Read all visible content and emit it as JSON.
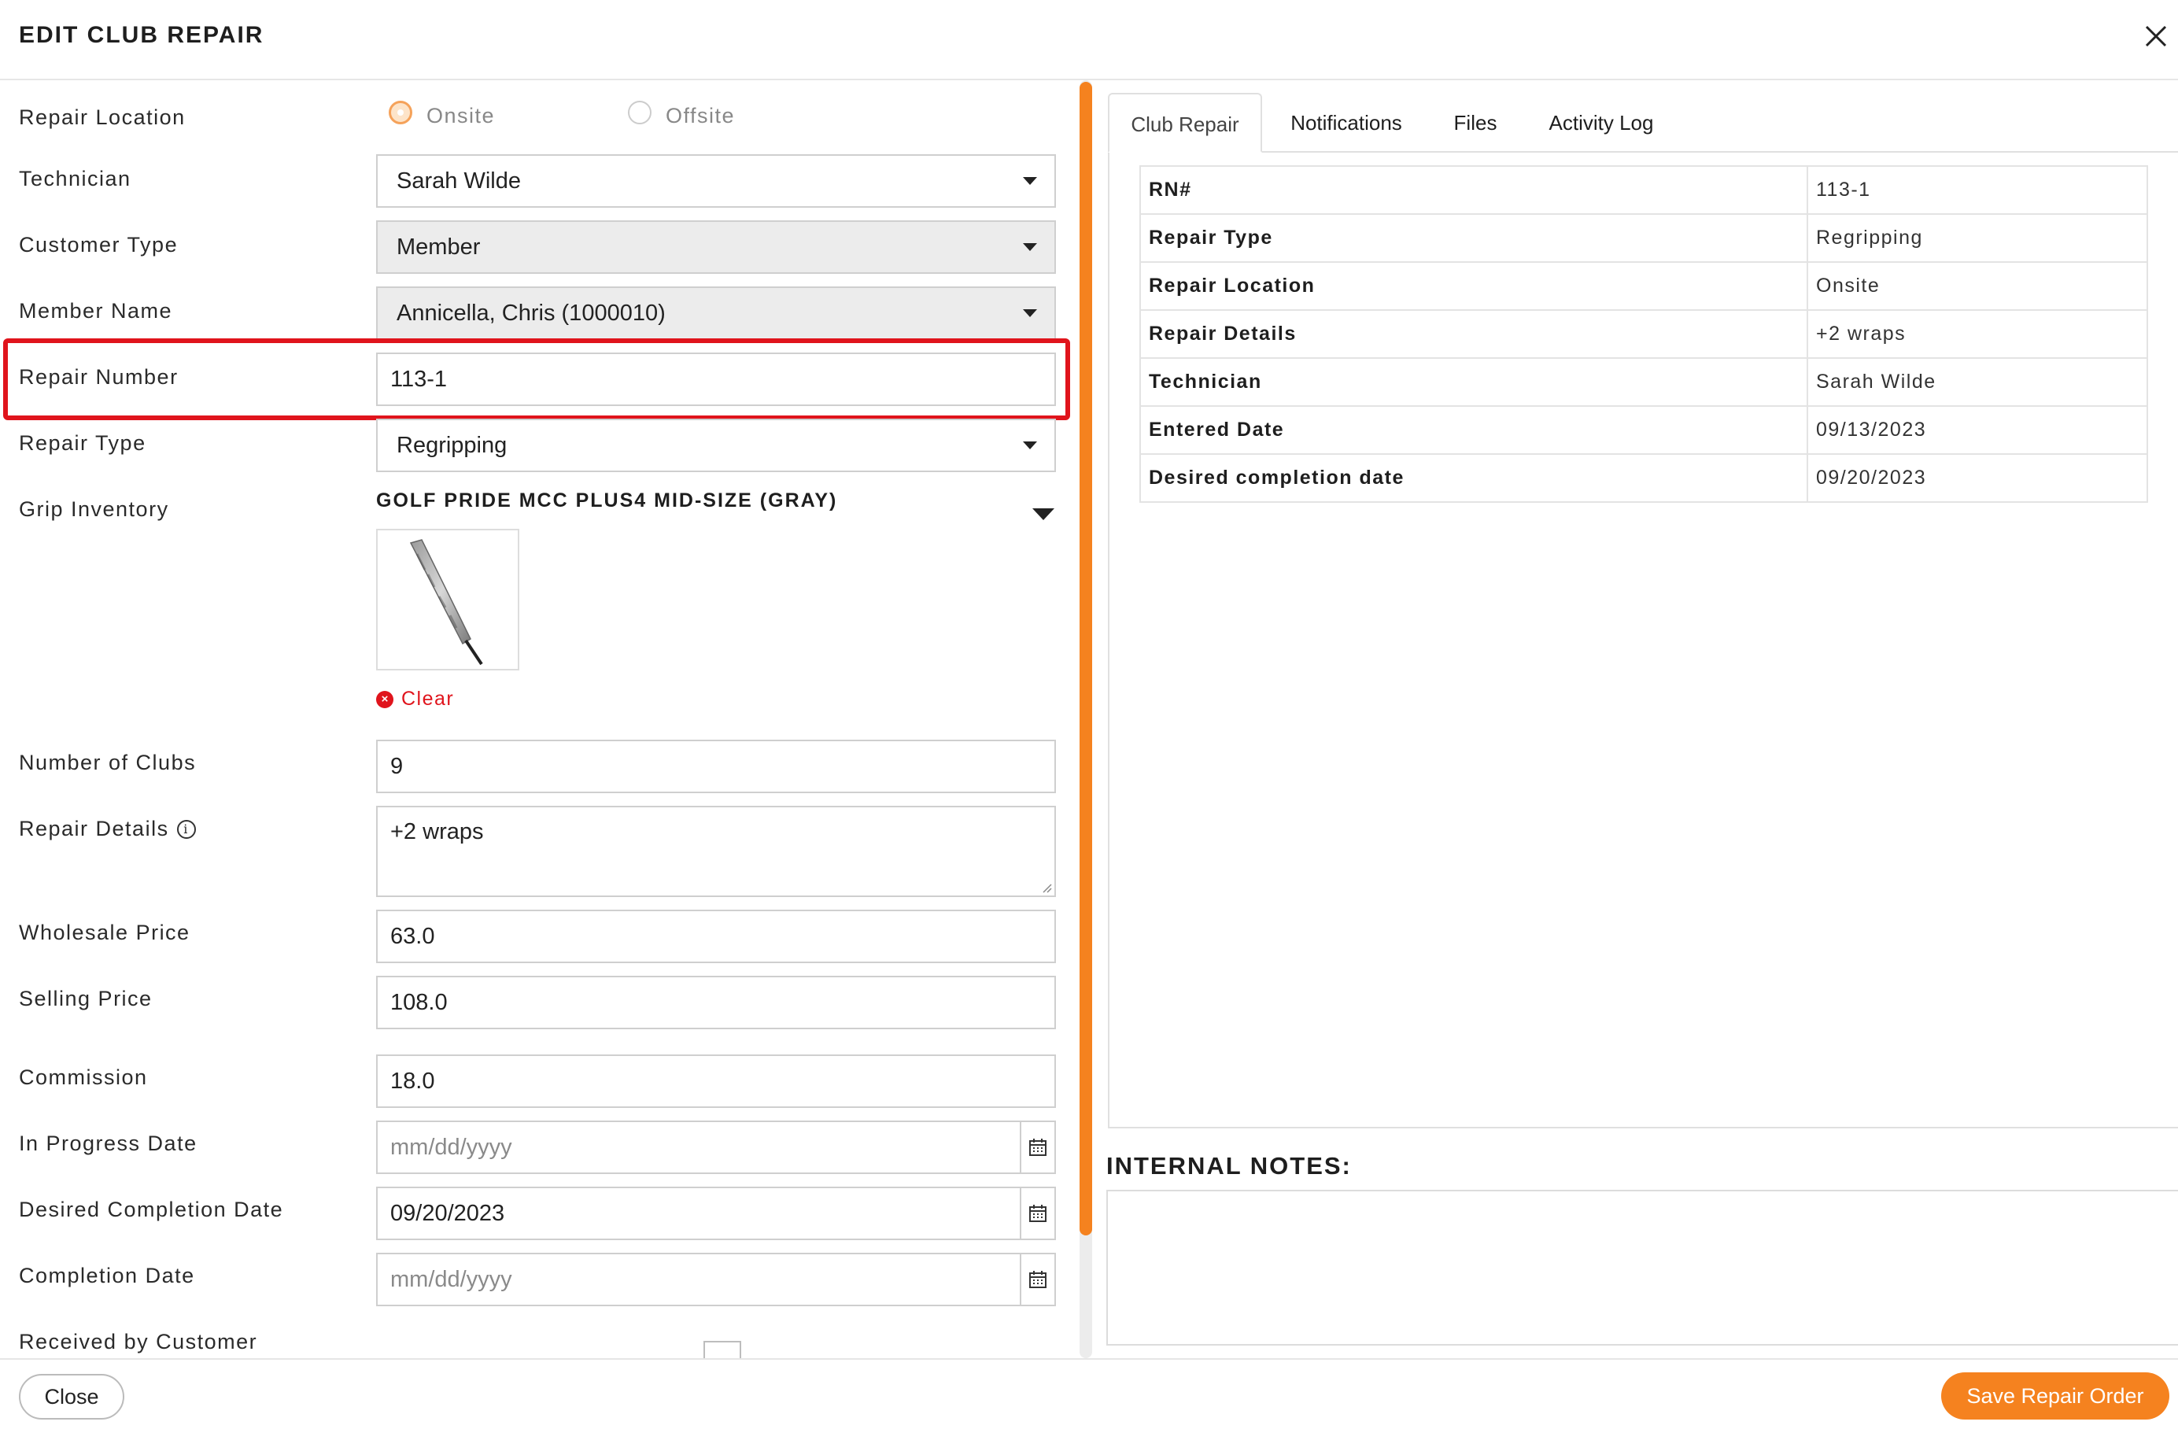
{
  "header": {
    "title": "EDIT CLUB REPAIR"
  },
  "form": {
    "repair_location": {
      "label": "Repair Location",
      "options": [
        "Onsite",
        "Offsite"
      ],
      "selected": "Onsite"
    },
    "technician": {
      "label": "Technician",
      "value": "Sarah Wilde"
    },
    "customer_type": {
      "label": "Customer Type",
      "value": "Member"
    },
    "member_name": {
      "label": "Member Name",
      "value": "Annicella, Chris (1000010)"
    },
    "repair_number": {
      "label": "Repair Number",
      "value": "113-1"
    },
    "repair_type": {
      "label": "Repair Type",
      "value": "Regripping"
    },
    "grip_inventory": {
      "label": "Grip Inventory",
      "value": "GOLF PRIDE MCC PLUS4 MID-SIZE (GRAY)",
      "clear_label": "Clear"
    },
    "number_of_clubs": {
      "label": "Number of Clubs",
      "value": "9"
    },
    "repair_details": {
      "label": "Repair Details",
      "value": "+2 wraps"
    },
    "wholesale_price": {
      "label": "Wholesale Price",
      "value": "63.0"
    },
    "selling_price": {
      "label": "Selling Price",
      "value": "108.0"
    },
    "commission": {
      "label": "Commission",
      "value": "18.0"
    },
    "in_progress_date": {
      "label": "In Progress Date",
      "placeholder": "mm/dd/yyyy"
    },
    "desired_completion_date": {
      "label": "Desired Completion Date",
      "value": "09/20/2023"
    },
    "completion_date": {
      "label": "Completion Date",
      "placeholder": "mm/dd/yyyy"
    },
    "received_by_customer": {
      "label": "Received by Customer",
      "checked": false
    }
  },
  "tabs": [
    "Club Repair",
    "Notifications",
    "Files",
    "Activity Log"
  ],
  "active_tab": "Club Repair",
  "summary": [
    {
      "key": "RN#",
      "value": "113-1"
    },
    {
      "key": "Repair Type",
      "value": "Regripping"
    },
    {
      "key": "Repair Location",
      "value": "Onsite"
    },
    {
      "key": "Repair Details",
      "value": "+2 wraps"
    },
    {
      "key": "Technician",
      "value": "Sarah Wilde"
    },
    {
      "key": "Entered Date",
      "value": "09/13/2023"
    },
    {
      "key": "Desired completion date",
      "value": "09/20/2023"
    }
  ],
  "internal_notes": {
    "title": "INTERNAL NOTES:",
    "value": ""
  },
  "footer": {
    "close_label": "Close",
    "save_label": "Save Repair Order"
  },
  "colors": {
    "accent": "#f5821f",
    "highlight": "#e0141c"
  }
}
